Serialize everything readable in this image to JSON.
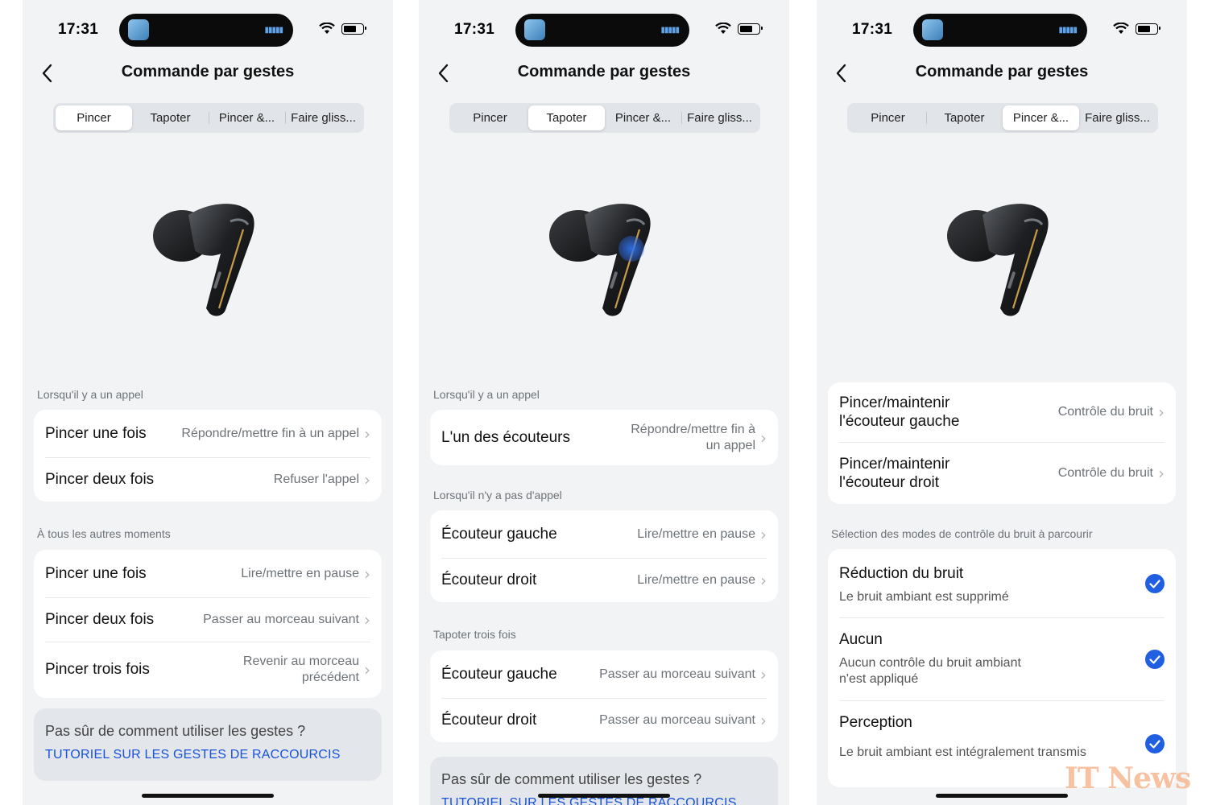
{
  "status_bar": {
    "time": "17:31"
  },
  "screens": [
    {
      "title": "Commande par gestes",
      "tabs": [
        "Pincer",
        "Tapoter",
        "Pincer &...",
        "Faire gliss..."
      ],
      "selected_tab": 0,
      "sections": [
        {
          "label": "Lorsqu'il y a un appel",
          "rows": [
            {
              "label": "Pincer une fois",
              "value": "Répondre/mettre fin à un appel"
            },
            {
              "label": "Pincer deux fois",
              "value": "Refuser l'appel"
            }
          ]
        },
        {
          "label": "À tous les autres moments",
          "rows": [
            {
              "label": "Pincer une fois",
              "value": "Lire/mettre en pause"
            },
            {
              "label": "Pincer deux fois",
              "value": "Passer au morceau suivant"
            },
            {
              "label": "Pincer trois fois",
              "value_line1": "Revenir au morceau",
              "value_line2": "précédent"
            }
          ]
        }
      ],
      "help": {
        "question": "Pas sûr de comment utiliser les gestes ?",
        "link": "TUTORIEL SUR LES GESTES DE RACCOURCIS"
      }
    },
    {
      "title": "Commande par gestes",
      "tabs": [
        "Pincer",
        "Tapoter",
        "Pincer &...",
        "Faire gliss..."
      ],
      "selected_tab": 1,
      "sections": [
        {
          "label": "Lorsqu'il y a un appel",
          "rows": [
            {
              "label": "L'un des écouteurs",
              "value_line1": "Répondre/mettre fin à",
              "value_line2": "un appel"
            }
          ]
        },
        {
          "label": "Lorsqu'il n'y a pas d'appel",
          "rows": [
            {
              "label": "Écouteur gauche",
              "value": "Lire/mettre en pause"
            },
            {
              "label": "Écouteur droit",
              "value": "Lire/mettre en pause"
            }
          ]
        },
        {
          "label": "Tapoter trois fois",
          "rows": [
            {
              "label": "Écouteur gauche",
              "value": "Passer au morceau suivant"
            },
            {
              "label": "Écouteur droit",
              "value": "Passer au morceau suivant"
            }
          ]
        }
      ],
      "help": {
        "question": "Pas sûr de comment utiliser les gestes ?",
        "link": "TUTORIEL SUR LES GESTES DE RACCOURCIS"
      }
    },
    {
      "title": "Commande par gestes",
      "tabs": [
        "Pincer",
        "Tapoter",
        "Pincer &...",
        "Faire gliss..."
      ],
      "selected_tab": 2,
      "rows": [
        {
          "label_line1": "Pincer/maintenir",
          "label_line2": "l'écouteur gauche",
          "value": "Contrôle du bruit"
        },
        {
          "label_line1": "Pincer/maintenir",
          "label_line2": "l'écouteur droit",
          "value": "Contrôle du bruit"
        }
      ],
      "modes_label": "Sélection des modes de contrôle du bruit à parcourir",
      "modes": [
        {
          "title": "Réduction du bruit",
          "desc": "Le bruit ambiant est supprimé",
          "checked": true
        },
        {
          "title": "Aucun",
          "desc_line1": "Aucun contrôle du bruit ambiant",
          "desc_line2": "n'est appliqué",
          "checked": true
        },
        {
          "title": "Perception",
          "desc": "Le bruit ambiant est intégralement transmis",
          "checked": true
        }
      ]
    }
  ],
  "watermark": "IT News",
  "colors": {
    "accent": "#1f5fe0",
    "link": "#1852d9",
    "background": "#f1f3f5",
    "card": "#ffffff",
    "tap_highlight": "#2f6fe8"
  },
  "icons": [
    "app-thumbnail-icon",
    "audio-wave-icon",
    "wifi-icon",
    "battery-icon",
    "back-chevron-icon",
    "chevron-right-icon",
    "checkmark-icon"
  ]
}
